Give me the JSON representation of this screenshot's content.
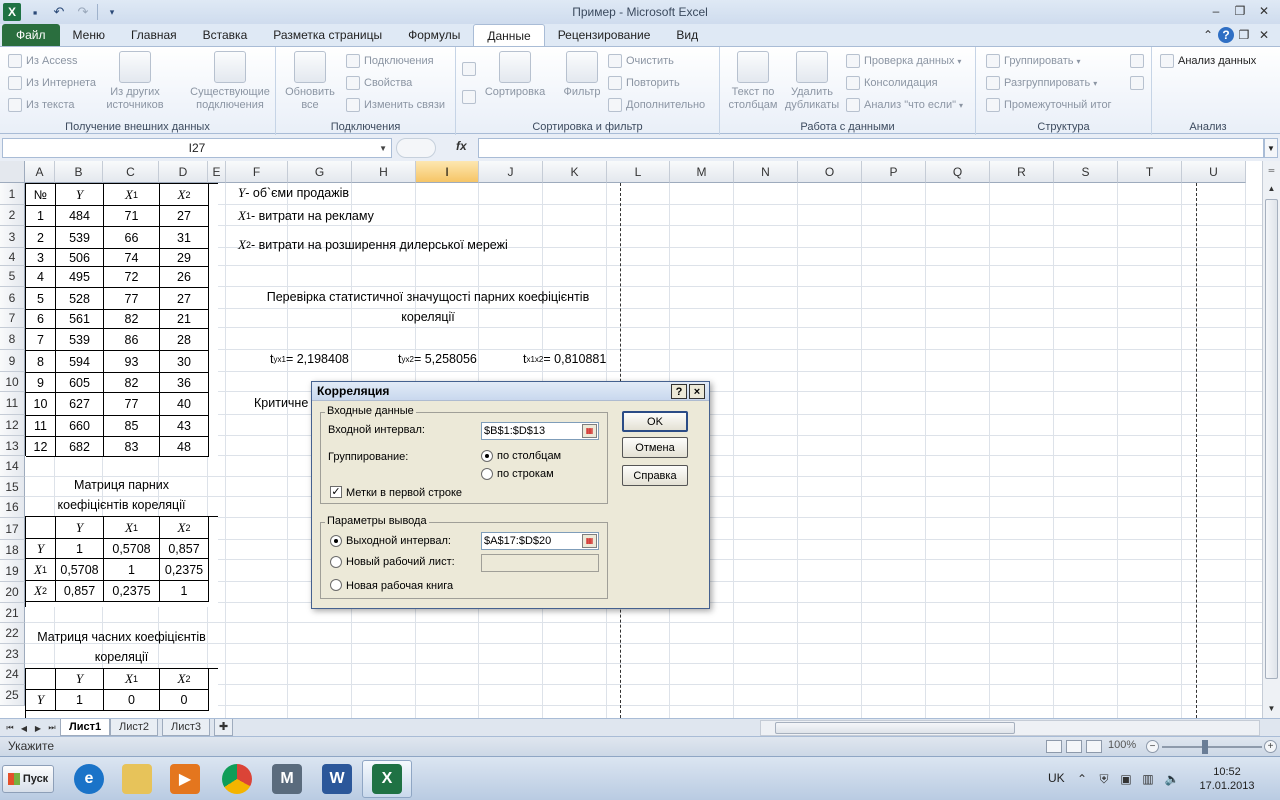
{
  "window": {
    "title": "Пример  -  Microsoft Excel",
    "logo": "X"
  },
  "ribbon_tabs": [
    "Файл",
    "Меню",
    "Главная",
    "Вставка",
    "Разметка страницы",
    "Формулы",
    "Данные",
    "Рецензирование",
    "Вид"
  ],
  "ribbon": {
    "external_data": {
      "label": "Получение внешних данных",
      "access": "Из Access",
      "web": "Из Интернета",
      "text": "Из текста",
      "other": "Из других источников",
      "existing": "Существующие подключения"
    },
    "connections": {
      "label": "Подключения",
      "refresh": "Обновить все",
      "connections": "Подключения",
      "properties": "Свойства",
      "edit_links": "Изменить связи"
    },
    "sort_filter": {
      "label": "Сортировка и фильтр",
      "sort": "Сортировка",
      "filter": "Фильтр",
      "clear": "Очистить",
      "reapply": "Повторить",
      "advanced": "Дополнительно"
    },
    "data_tools": {
      "label": "Работа с данными",
      "text_to_columns": "Текст по столбцам",
      "remove_duplicates": "Удалить дубликаты",
      "validation": "Проверка данных",
      "consolidate": "Консолидация",
      "what_if": "Анализ \"что если\""
    },
    "outline": {
      "label": "Структура",
      "group": "Группировать",
      "ungroup": "Разгруппировать",
      "subtotal": "Промежуточный итог"
    },
    "analysis": {
      "label": "Анализ",
      "data_analysis": "Анализ данных"
    }
  },
  "formula_bar": {
    "name_box": "I27",
    "fx": "fx",
    "value": ""
  },
  "columns": [
    "A",
    "B",
    "C",
    "D",
    "E",
    "F",
    "G",
    "H",
    "I",
    "J",
    "K",
    "L",
    "M",
    "N",
    "O",
    "P",
    "Q",
    "R",
    "S",
    "T",
    "U"
  ],
  "rows": [
    "1",
    "2",
    "3",
    "4",
    "5",
    "6",
    "7",
    "8",
    "9",
    "10",
    "11",
    "12",
    "13",
    "14",
    "15",
    "16",
    "17",
    "18",
    "19",
    "20",
    "21",
    "22",
    "23",
    "24",
    "25"
  ],
  "data_table": {
    "header": [
      "№",
      "Y",
      "X1",
      "X2"
    ],
    "rows": [
      [
        "1",
        "484",
        "71",
        "27"
      ],
      [
        "2",
        "539",
        "66",
        "31"
      ],
      [
        "3",
        "506",
        "74",
        "29"
      ],
      [
        "4",
        "495",
        "72",
        "26"
      ],
      [
        "5",
        "528",
        "77",
        "27"
      ],
      [
        "6",
        "561",
        "82",
        "21"
      ],
      [
        "7",
        "539",
        "86",
        "28"
      ],
      [
        "8",
        "594",
        "93",
        "30"
      ],
      [
        "9",
        "605",
        "82",
        "36"
      ],
      [
        "10",
        "627",
        "77",
        "40"
      ],
      [
        "11",
        "660",
        "85",
        "43"
      ],
      [
        "12",
        "682",
        "83",
        "48"
      ]
    ]
  },
  "pair_matrix": {
    "title_line1": "Матриця парних",
    "title_line2": "коефіцієнтів кореляції",
    "header": [
      "",
      "Y",
      "X1",
      "X2"
    ],
    "rows": [
      [
        "Y",
        "1",
        "0,5708",
        "0,857"
      ],
      [
        "X1",
        "0,5708",
        "1",
        "0,2375"
      ],
      [
        "X2",
        "0,857",
        "0,2375",
        "1"
      ]
    ]
  },
  "partial_matrix": {
    "title_line1": "Матриця часних коефіцієнтів",
    "title_line2": "кореляції",
    "header": [
      "",
      "Y",
      "X1",
      "X2"
    ],
    "rows": [
      [
        "Y",
        "1",
        "0",
        "0"
      ]
    ]
  },
  "notes": {
    "y_var": "Y",
    "y_text": " - об`єми продажів",
    "x1_var": "X",
    "x1_sub": "1",
    "x1_text": " - витрати на рекламу",
    "x2_var": "X",
    "x2_sub": "2",
    "x2_text": " - витрати на розширення дилерської мережі",
    "check_line1": "Перевірка статистичної значущості парних коефіцієнтів",
    "check_line2": "кореляції",
    "t1_label": "t",
    "t1_sub": "yx1",
    "t1_value": "= 2,198408",
    "t2_label": "t",
    "t2_sub": "yx2",
    "t2_value": "= 5,258056",
    "t3_label": "t",
    "t3_sub": "x1x2",
    "t3_value": "= 0,810881",
    "critical": "Критичне"
  },
  "dialog": {
    "title": "Корреляция",
    "help_btn": "?",
    "close_btn": "×",
    "input_group": "Входные данные",
    "input_range_label": "Входной интервал:",
    "input_range_value": "$B$1:$D$13",
    "grouping_label": "Группирование:",
    "by_columns": "по столбцам",
    "by_rows": "по строкам",
    "labels_first_row": "Метки в первой строке",
    "output_group": "Параметры вывода",
    "output_range_label": "Выходной интервал:",
    "output_range_value": "$A$17:$D$20",
    "new_sheet": "Новый рабочий лист:",
    "new_book": "Новая рабочая книга",
    "ok": "OK",
    "cancel": "Отмена",
    "help": "Справка"
  },
  "sheet_tabs": [
    "Лист1",
    "Лист2",
    "Лист3"
  ],
  "status": {
    "mode": "Укажите",
    "zoom": "100%"
  },
  "taskbar": {
    "start": "Пуск",
    "lang": "UK",
    "time": "10:52",
    "date": "17.01.2013"
  }
}
